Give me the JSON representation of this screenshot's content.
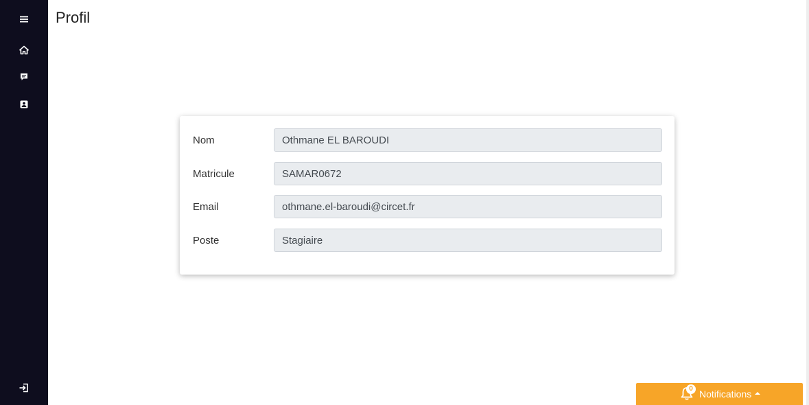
{
  "sidebar": {
    "icons": [
      "menu-icon",
      "home-icon",
      "message-icon",
      "contact-card-icon",
      "logout-icon"
    ]
  },
  "page": {
    "title": "Profil"
  },
  "profile": {
    "fields": [
      {
        "label": "Nom",
        "value": "Othmane EL BAROUDI"
      },
      {
        "label": "Matricule",
        "value": "SAMAR0672"
      },
      {
        "label": "Email",
        "value": "othmane.el-baroudi@circet.fr"
      },
      {
        "label": "Poste",
        "value": "Stagiaire"
      }
    ]
  },
  "notifications": {
    "label": "Notifications",
    "count": "0",
    "icon": "bell-icon"
  },
  "colors": {
    "sidebar": "#0e0d1e",
    "accent": "#f7a528",
    "input_bg": "#e9ecef"
  }
}
